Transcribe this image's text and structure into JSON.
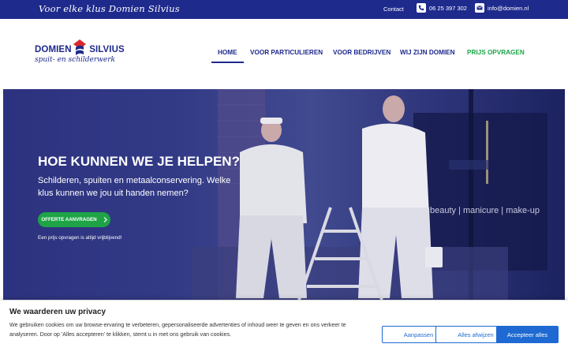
{
  "topbar": {
    "slogan": "Voor elke klus Domien Silvius",
    "contact": "Contact",
    "phone": "06 25 397 302",
    "email": "info@domien.nl"
  },
  "logo": {
    "brand_left": "DOMIEN",
    "brand_right": "SILVIUS",
    "tagline": "spuit- en schilderwerk"
  },
  "nav": [
    {
      "label": "HOME"
    },
    {
      "label": "VOOR PARTICULIEREN"
    },
    {
      "label": "VOOR BEDRIJVEN"
    },
    {
      "label": "WIJ ZIJN DOMIEN"
    },
    {
      "label": "PRIJS OPVRAGEN"
    }
  ],
  "hero": {
    "title": "HOE KUNNEN WE JE HELPEN?",
    "text": "Schilderen, spuiten en metaalconservering. Welke klus kunnen we jou uit handen nemen?",
    "button": "OFFERTE AANVRAGEN",
    "note": "Een prijs opvragen is altijd vrijblijvend!",
    "window_text": "beauty | manicure | make-up"
  },
  "cookie": {
    "title": "We waarderen uw privacy",
    "text": "We gebruiken cookies om uw browse-ervaring te verbeteren, gepersonaliseerde advertenties of inhoud weer te geven en ons verkeer te analyseren. Door op 'Alles accepteren' te klikken, stemt u in met ons gebruik van cookies.",
    "customize": "Aanpassen",
    "reject": "Alles afwijzen",
    "accept": "Accepteer alles"
  },
  "colors": {
    "brand_blue": "#1e2a8c",
    "accent_green": "#1ea447",
    "button_blue": "#1e6ad2",
    "logo_red": "#d9282f"
  }
}
